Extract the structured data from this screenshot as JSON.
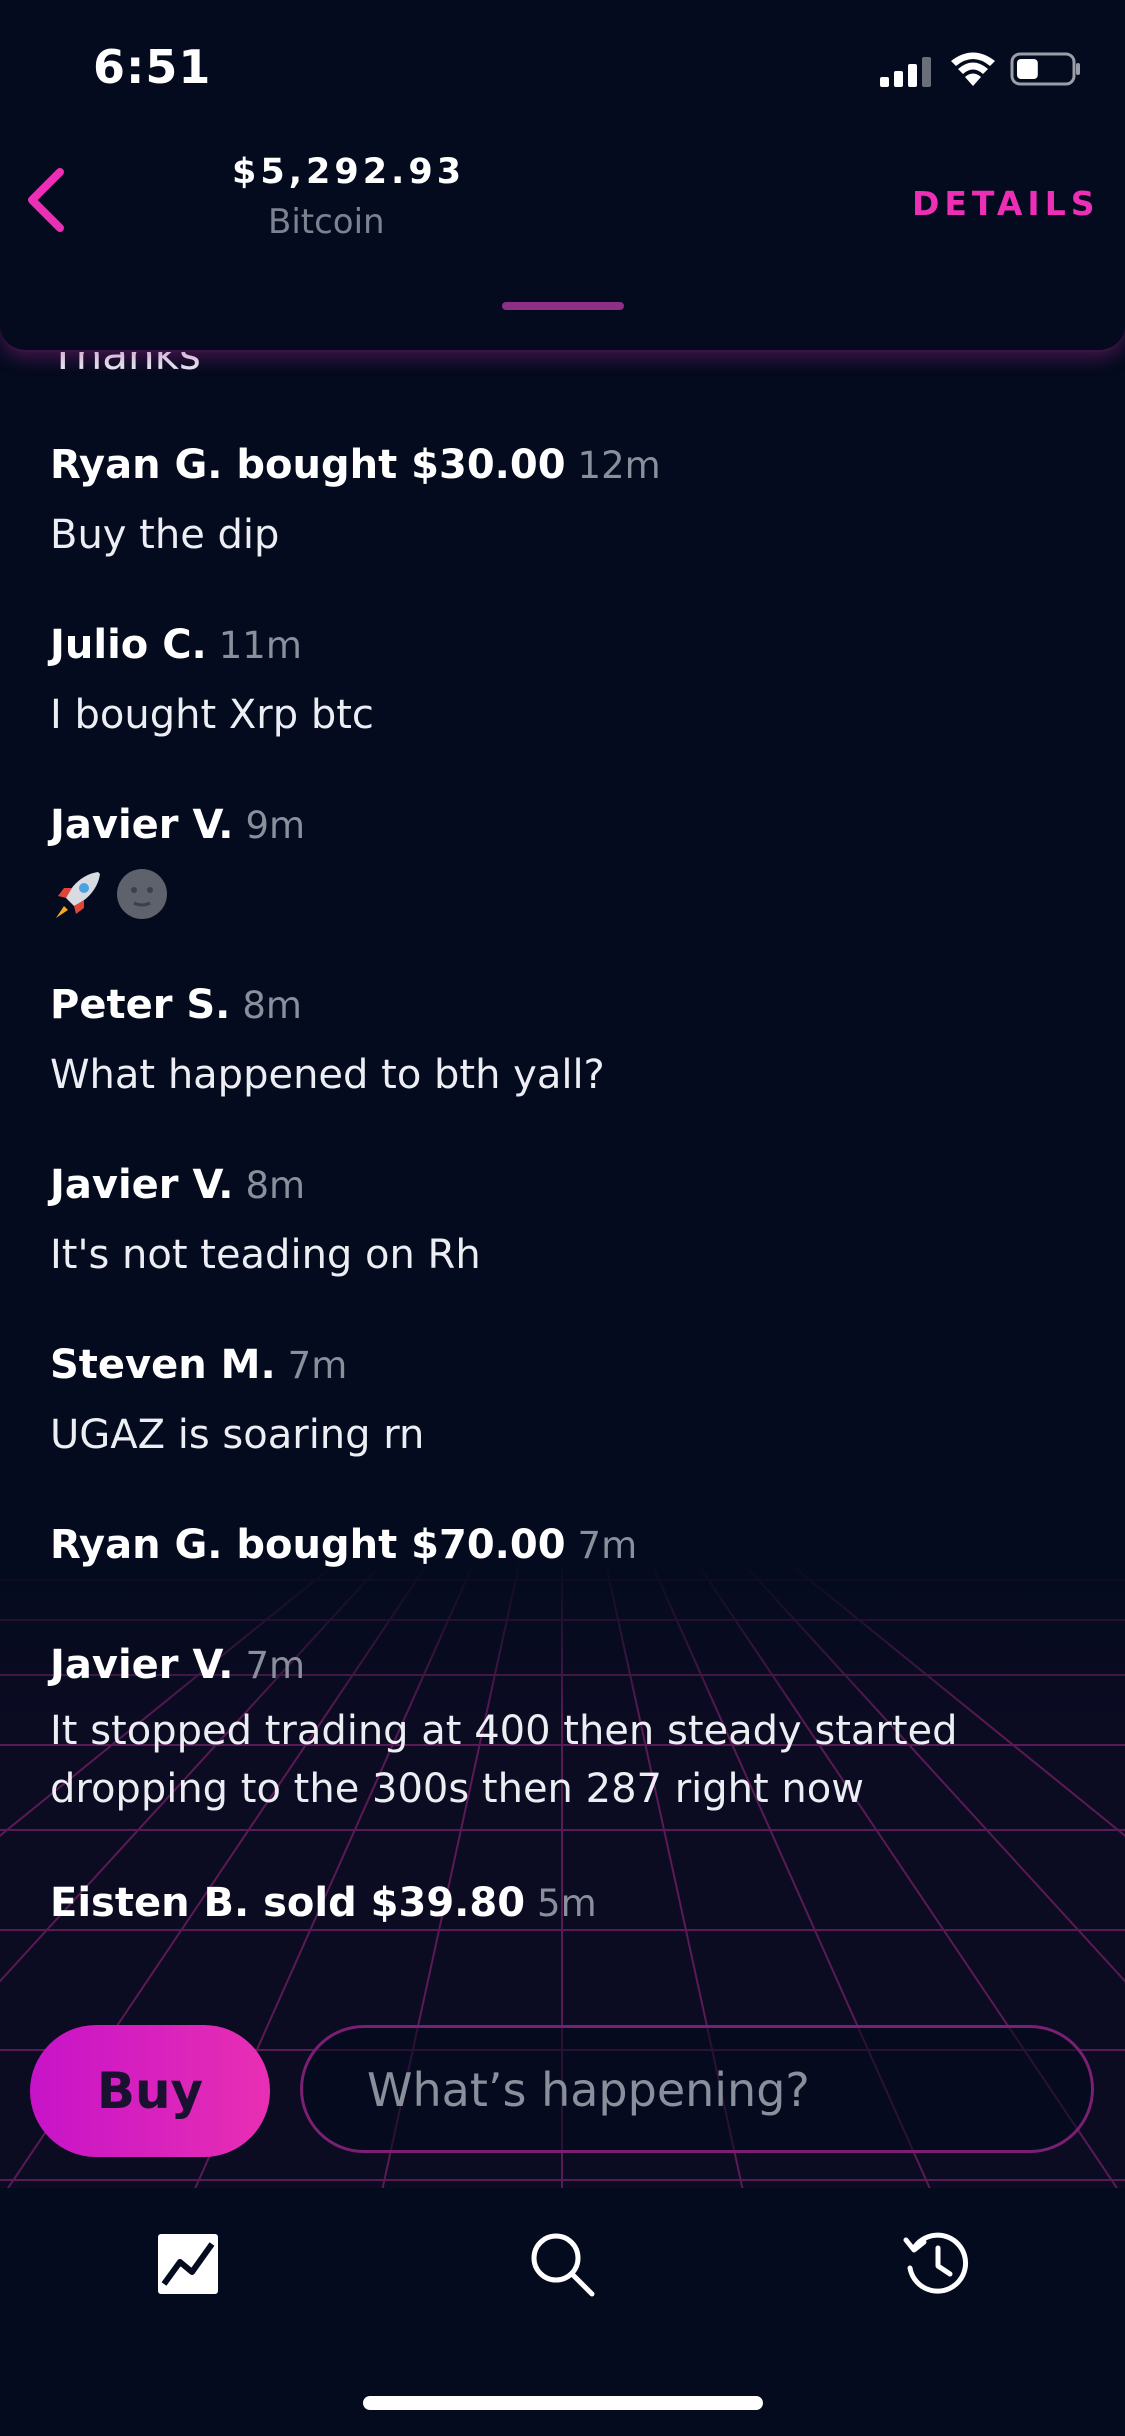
{
  "status_bar": {
    "time": "6:51",
    "battery_level": 0.4
  },
  "header": {
    "price": "$5,292.93",
    "asset": "Bitcoin",
    "details_label": "DETAILS"
  },
  "feed": {
    "partial_previous": "Thanks",
    "messages": [
      {
        "name": "Ryan G. bought $30.00",
        "ago": "12m",
        "text": "Buy the dip"
      },
      {
        "name": "Julio C.",
        "ago": "11m",
        "text": "I bought Xrp btc"
      },
      {
        "name": "Javier V.",
        "ago": "9m",
        "text": "🚀🌑"
      },
      {
        "name": "Peter S.",
        "ago": "8m",
        "text": "What happened to bth yall?"
      },
      {
        "name": "Javier V.",
        "ago": "8m",
        "text": "It's not teading on Rh"
      },
      {
        "name": "Steven M.",
        "ago": "7m",
        "text": "UGAZ is soaring rn"
      },
      {
        "name": "Ryan G. bought $70.00",
        "ago": "7m",
        "text": ""
      },
      {
        "name": "Javier V.",
        "ago": "7m",
        "text_line1": "It stopped trading at 400 then steady started",
        "text_line2": "dropping to the 300s then 287 right now"
      },
      {
        "name": "Eisten B. sold $39.80",
        "ago": "5m",
        "text": ""
      }
    ]
  },
  "composer": {
    "buy_label": "Buy",
    "placeholder": "What’s happening?"
  },
  "tabs": {
    "chart_icon": "chart-icon",
    "search_icon": "search-icon",
    "history_icon": "history-icon"
  },
  "colors": {
    "accent": "#ec2fb5",
    "background": "#040b1e"
  }
}
